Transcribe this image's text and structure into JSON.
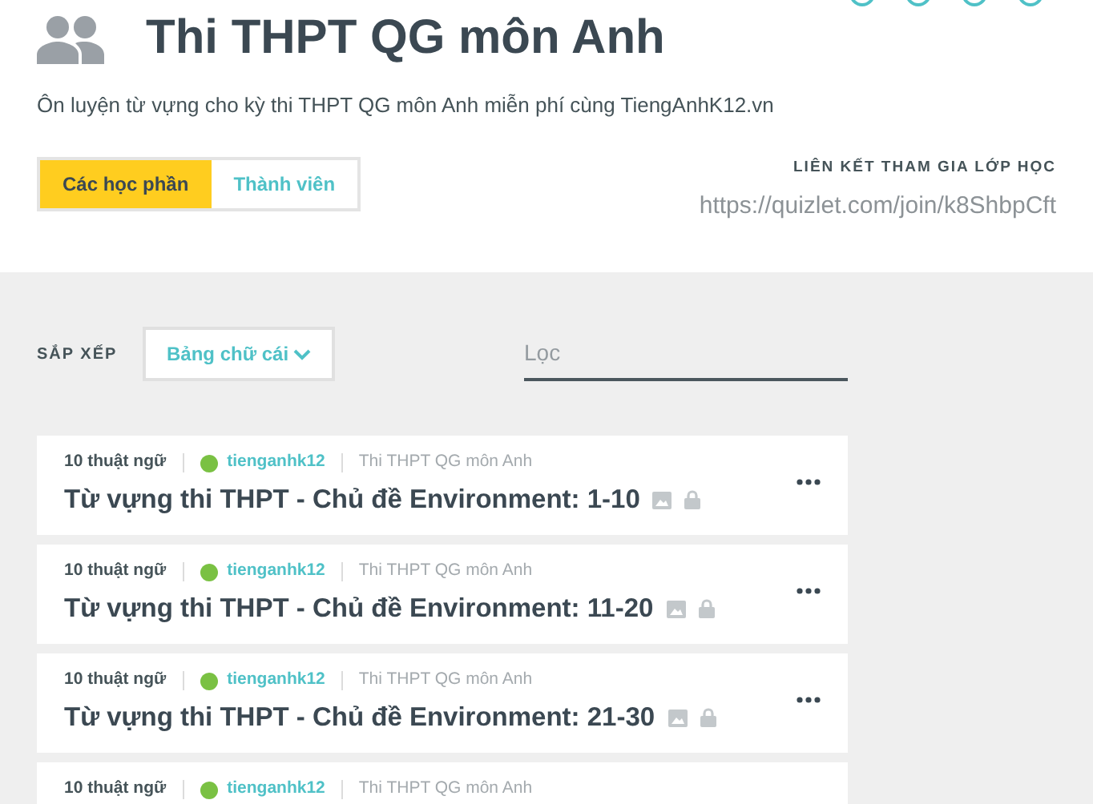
{
  "header": {
    "title": "Thi THPT QG môn Anh",
    "description": "Ôn luyện từ vựng cho kỳ thi THPT QG môn Anh miễn phí cùng TiengAnhK12.vn"
  },
  "tabs": [
    {
      "label": "Các học phần",
      "selected": true
    },
    {
      "label": "Thành viên",
      "selected": false
    }
  ],
  "join_link": {
    "label": "LIÊN KẾT THAM GIA LỚP HỌC",
    "url": "https://quizlet.com/join/k8ShbpCft"
  },
  "sort": {
    "label": "SẮP XẾP",
    "value": "Bảng chữ cái"
  },
  "filter": {
    "placeholder": "Lọc"
  },
  "sets": [
    {
      "terms": "10 thuật ngữ",
      "author": "tienganhk12",
      "class": "Thi THPT QG môn Anh",
      "title": "Từ vựng thi THPT - Chủ đề Environment: 1-10"
    },
    {
      "terms": "10 thuật ngữ",
      "author": "tienganhk12",
      "class": "Thi THPT QG môn Anh",
      "title": "Từ vựng thi THPT - Chủ đề Environment: 11-20"
    },
    {
      "terms": "10 thuật ngữ",
      "author": "tienganhk12",
      "class": "Thi THPT QG môn Anh",
      "title": "Từ vựng thi THPT - Chủ đề Environment: 21-30"
    },
    {
      "terms": "10 thuật ngữ",
      "author": "tienganhk12",
      "class": "Thi THPT QG môn Anh"
    }
  ]
}
